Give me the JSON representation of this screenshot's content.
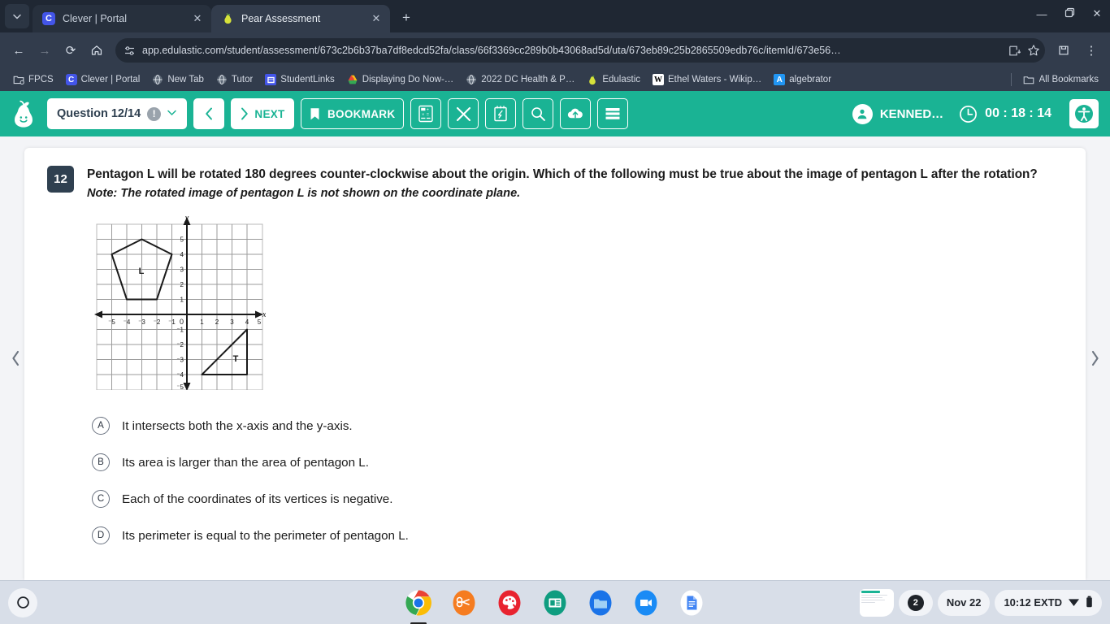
{
  "browser": {
    "tabs": [
      {
        "title": "Clever | Portal",
        "favicon": "clever-c-icon",
        "active": false
      },
      {
        "title": "Pear Assessment",
        "favicon": "pear-icon",
        "active": true
      }
    ],
    "new_tab_label": "+",
    "window_controls": {
      "minimize": "—",
      "maximize": "❐",
      "close": "✕"
    },
    "nav": {
      "back": "←",
      "forward": "→",
      "reload": "⟳",
      "home": "⌂"
    },
    "url": "app.edulastic.com/student/assessment/673c2b6b37ba7df8edcd52fa/class/66f3369cc289b0b43068ad5d/uta/673eb89c25b2865509edb76c/itemId/673e56…",
    "omnibox_icons": [
      "site-settings-icon",
      "install-app-icon",
      "bookmark-star-icon"
    ],
    "toolbar_right_icons": [
      "extensions-icon",
      "browser-menu-icon"
    ],
    "bookmarks": [
      {
        "label": "FPCS",
        "icon": "folder-settings-icon"
      },
      {
        "label": "Clever | Portal",
        "icon": "clever-c-icon"
      },
      {
        "label": "New Tab",
        "icon": "globe-icon"
      },
      {
        "label": "Tutor",
        "icon": "globe-icon"
      },
      {
        "label": "StudentLinks",
        "icon": "slides-icon"
      },
      {
        "label": "Displaying Do Now-…",
        "icon": "google-drive-icon"
      },
      {
        "label": "2022 DC Health & P…",
        "icon": "globe-icon"
      },
      {
        "label": "Edulastic",
        "icon": "pear-icon"
      },
      {
        "label": "Ethel Waters - Wikip…",
        "icon": "wikipedia-icon"
      },
      {
        "label": "algebrator",
        "icon": "algebrator-icon"
      }
    ],
    "all_bookmarks_label": "All Bookmarks"
  },
  "appbar": {
    "logo": "pear-assessment-logo",
    "question_selector": {
      "label": "Question 12/14",
      "warn_icon": "warning-icon",
      "chevron": "⌄"
    },
    "prev_label": "‹",
    "next_label": "NEXT",
    "next_chevron": "›",
    "bookmark_label": "BOOKMARK",
    "tools": [
      {
        "name": "calculator-icon"
      },
      {
        "name": "crossout-x-icon"
      },
      {
        "name": "scratchpad-icon"
      },
      {
        "name": "magnifier-icon"
      },
      {
        "name": "cloud-upload-icon"
      },
      {
        "name": "question-list-icon"
      }
    ],
    "user_name": "KENNED…",
    "timer": "00 : 18 : 14",
    "accessibility_icon": "accessibility-icon",
    "accent_color": "#1ab394"
  },
  "question": {
    "number": "12",
    "prompt": "Pentagon L will be rotated 180 degrees counter-clockwise about the origin. Which of the following must be true about the image of pentagon L after the rotation?",
    "note": "Note: The rotated image of pentagon L is not shown on the coordinate plane.",
    "options": [
      {
        "letter": "A",
        "text": "It intersects both the x-axis and the y-axis."
      },
      {
        "letter": "B",
        "text": "Its area is larger than the area of pentagon L."
      },
      {
        "letter": "C",
        "text": "Each of the coordinates of its vertices is negative."
      },
      {
        "letter": "D",
        "text": "Its perimeter is equal to the perimeter of pentagon L."
      }
    ]
  },
  "chart_data": {
    "type": "scatter",
    "title": "",
    "xlabel": "x",
    "ylabel": "y",
    "xlim": [
      -6,
      6
    ],
    "ylim": [
      -6,
      6
    ],
    "grid": true,
    "x_ticks": [
      "⁻5",
      "⁻4",
      "⁻3",
      "⁻2",
      "⁻1",
      "0",
      "1",
      "2",
      "3",
      "4",
      "5"
    ],
    "y_ticks": [
      "5",
      "4",
      "3",
      "2",
      "1",
      "⁻1",
      "⁻2",
      "⁻3",
      "⁻4",
      "⁻5"
    ],
    "origin_label": "0",
    "shapes": [
      {
        "label": "L",
        "kind": "pentagon",
        "label_position": [
          -3,
          3
        ],
        "vertices": [
          [
            -3,
            5
          ],
          [
            -1,
            4
          ],
          [
            -2,
            1
          ],
          [
            -4,
            1
          ],
          [
            -5,
            4
          ]
        ]
      },
      {
        "label": "T",
        "kind": "triangle",
        "label_position": [
          3.3,
          -3
        ],
        "vertices": [
          [
            1,
            -4
          ],
          [
            4,
            -4
          ],
          [
            4,
            -1
          ]
        ]
      }
    ]
  },
  "nav_arrows": {
    "left": "‹",
    "right": "›"
  },
  "shelf": {
    "launcher_icon": "launcher-circle-icon",
    "apps": [
      {
        "name": "chrome-icon",
        "active": true
      },
      {
        "name": "scissors-icon",
        "active": false
      },
      {
        "name": "paint-icon",
        "active": false
      },
      {
        "name": "classroom-icon",
        "active": false
      },
      {
        "name": "files-icon",
        "active": false
      },
      {
        "name": "meet-icon",
        "active": false
      },
      {
        "name": "docs-icon",
        "active": false
      }
    ],
    "preview_icon": "window-preview-icon",
    "notification_count": "2",
    "date": "Nov 22",
    "time": "10:12 EXTD",
    "wifi_icon": "wifi-icon",
    "battery_icon": "battery-icon"
  }
}
